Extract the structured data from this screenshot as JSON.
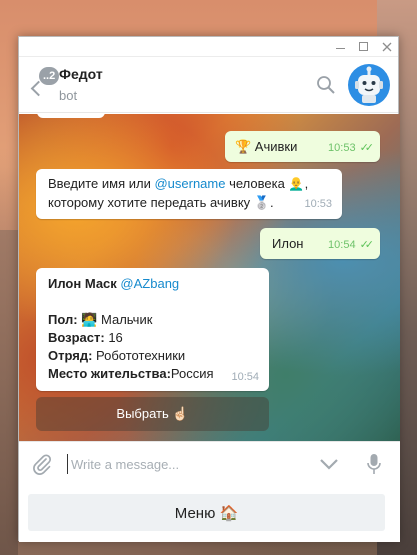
{
  "window": {
    "controls": [
      "minimize",
      "maximize",
      "close"
    ]
  },
  "header": {
    "title": "Федот",
    "subtitle": "bot",
    "unread_badge": "..2"
  },
  "messages": [
    {
      "text": "🏆 Ачивки",
      "time": "10:53",
      "direction": "out"
    },
    {
      "line1_prefix": "Введите имя или ",
      "line1_link": "@username",
      "line1_suffix": " человека 👨‍🦲,",
      "line2": "которому хотите передать ачивку 🥈.",
      "time": "10:53",
      "direction": "in"
    },
    {
      "text": "Илон",
      "time": "10:54",
      "direction": "out"
    },
    {
      "name": "Илон Маск",
      "link": "@AZbang",
      "gender_label": "Пол:",
      "gender_value": "🧑‍💻 Мальчик",
      "age_label": "Возраст:",
      "age_value": " 16",
      "squad_label": "Отряд:",
      "squad_value": " Робототехники",
      "place_label": "Место жительства:",
      "place_value": "Россия",
      "time": "10:54",
      "direction": "in"
    }
  ],
  "inline_button": {
    "label": "Выбрать ☝🏻"
  },
  "composer": {
    "placeholder": "Write a message..."
  },
  "menu": {
    "label": "Меню 🏠"
  },
  "colors": {
    "accent": "#168acd",
    "out_bubble": "#effdde",
    "check": "#5ec35a",
    "avatar_bg": "#2d8ee4"
  }
}
